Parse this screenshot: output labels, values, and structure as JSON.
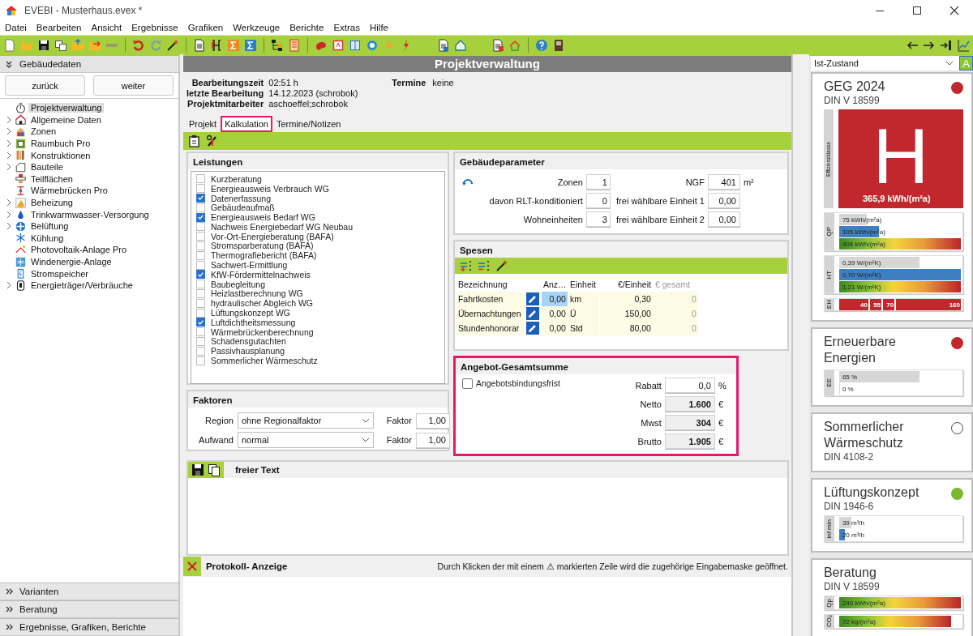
{
  "window": {
    "title": "EVEBI - Musterhaus.evex *"
  },
  "menu": [
    "Datei",
    "Bearbeiten",
    "Ansicht",
    "Ergebnisse",
    "Grafiken",
    "Werkzeuge",
    "Berichte",
    "Extras",
    "Hilfe"
  ],
  "sidebar": {
    "header": "Gebäudedaten",
    "back_button": "zurück",
    "next_button": "weiter",
    "items": [
      {
        "label": "Projektverwaltung",
        "expandable": false,
        "selected": true
      },
      {
        "label": "Allgemeine Daten",
        "expandable": true,
        "selected": false
      },
      {
        "label": "Zonen",
        "expandable": true,
        "selected": false
      },
      {
        "label": "Raumbuch Pro",
        "expandable": true,
        "selected": false
      },
      {
        "label": "Konstruktionen",
        "expandable": true,
        "selected": false
      },
      {
        "label": "Bauteile",
        "expandable": true,
        "selected": false
      },
      {
        "label": "Teilflächen",
        "expandable": false,
        "selected": false
      },
      {
        "label": "Wärmebrücken Pro",
        "expandable": false,
        "selected": false
      },
      {
        "label": "Beheizung",
        "expandable": true,
        "selected": false
      },
      {
        "label": "Trinkwarmwasser-Versorgung",
        "expandable": true,
        "selected": false
      },
      {
        "label": "Belüftung",
        "expandable": true,
        "selected": false
      },
      {
        "label": "Kühlung",
        "expandable": false,
        "selected": false
      },
      {
        "label": "Photovoltaik-Anlage Pro",
        "expandable": false,
        "selected": false
      },
      {
        "label": "Windenergie-Anlage",
        "expandable": false,
        "selected": false
      },
      {
        "label": "Stromspeicher",
        "expandable": false,
        "selected": false
      },
      {
        "label": "Energieträger/Verbräuche",
        "expandable": true,
        "selected": false
      }
    ],
    "sections": [
      "Varianten",
      "Beratung",
      "Ergebnisse, Grafiken, Berichte"
    ]
  },
  "page_title": "Projektverwaltung",
  "info": [
    {
      "label": "Bearbeitungszeit",
      "value": "02:51 h"
    },
    {
      "label": "letzte Bearbeitung",
      "value": "14.12.2023 (schrobok)"
    },
    {
      "label": "Projektmitarbeiter",
      "value": "aschoeffel;schrobok"
    }
  ],
  "termine": {
    "label": "Termine",
    "value": "keine"
  },
  "tabs": [
    {
      "label": "Projekt",
      "selected": false,
      "highlighted": false
    },
    {
      "label": "Kalkulation",
      "selected": true,
      "highlighted": true
    },
    {
      "label": "Termine/Notizen",
      "selected": false,
      "highlighted": false
    }
  ],
  "leistungen": {
    "title": "Leistungen",
    "items": [
      {
        "label": "Kurzberatung",
        "checked": false
      },
      {
        "label": "Energieausweis Verbrauch WG",
        "checked": false
      },
      {
        "label": "Datenerfassung",
        "checked": true
      },
      {
        "label": "Gebäudeaufmaß",
        "checked": false
      },
      {
        "label": "Energieausweis Bedarf WG",
        "checked": true
      },
      {
        "label": "Nachweis Energiebedarf WG Neubau",
        "checked": false
      },
      {
        "label": "Vor-Ort-Energieberatung (BAFA)",
        "checked": false
      },
      {
        "label": "Stromsparberatung (BAFA)",
        "checked": false
      },
      {
        "label": "Thermografiebericht (BAFA)",
        "checked": false
      },
      {
        "label": "Sachwert-Ermittlung",
        "checked": false
      },
      {
        "label": "KfW-Fördermittelnachweis",
        "checked": true
      },
      {
        "label": "Baubegleitung",
        "checked": false
      },
      {
        "label": "Heizlastberechnung WG",
        "checked": false
      },
      {
        "label": "hydraulischer Abgleich WG",
        "checked": false
      },
      {
        "label": "Lüftungskonzept WG",
        "checked": false
      },
      {
        "label": "Luftdichtheitsmessung",
        "checked": true
      },
      {
        "label": "Wärmebrückenberechnung",
        "checked": false
      },
      {
        "label": "Schadensgutachten",
        "checked": false
      },
      {
        "label": "Passivhausplanung",
        "checked": false
      },
      {
        "label": "Sommerlicher Wärmeschutz",
        "checked": false
      }
    ]
  },
  "faktoren": {
    "title": "Faktoren",
    "rows": [
      {
        "label": "Region",
        "value": "ohne Regionalfaktor",
        "factor_label": "Faktor",
        "factor": "1,00"
      },
      {
        "label": "Aufwand",
        "value": "normal",
        "factor_label": "Faktor",
        "factor": "1,00"
      }
    ]
  },
  "gebaeudeparameter": {
    "title": "Gebäudeparameter",
    "left_fields": [
      {
        "label": "Zonen",
        "value": "1"
      },
      {
        "label": "davon RLT-konditioniert",
        "value": "0"
      },
      {
        "label": "Wohneinheiten",
        "value": "3"
      }
    ],
    "right_fields": [
      {
        "label": "NGF",
        "value": "401",
        "unit": "m²"
      },
      {
        "label": "frei wählbare Einheit 1",
        "value": "0,00"
      },
      {
        "label": "frei wählbare Einheit 2",
        "value": "0,00"
      }
    ]
  },
  "spesen": {
    "title": "Spesen",
    "columns": [
      "Bezeichnung",
      "Anz…",
      "Einheit",
      "€/Einheit",
      "€ gesamt"
    ],
    "rows": [
      {
        "name": "Fahrtkosten",
        "count": "0,00",
        "unit": "km",
        "price": "0,30",
        "total": "0",
        "selected": true
      },
      {
        "name": "Übernachtungen",
        "count": "0,00",
        "unit": "Ü",
        "price": "150,00",
        "total": "0",
        "selected": false
      },
      {
        "name": "Stundenhonorar",
        "count": "0,00",
        "unit": "Std",
        "price": "80,00",
        "total": "0",
        "selected": false
      }
    ]
  },
  "angebot": {
    "title": "Angebot-Gesamtsumme",
    "highlighted": true,
    "checkbox": {
      "label": "Angebotsbindungsfrist",
      "checked": false
    },
    "fields": [
      {
        "label": "Rabatt",
        "value": "0,0",
        "unit": "%",
        "kind": "input"
      },
      {
        "label": "Netto",
        "value": "1.600",
        "unit": "€",
        "kind": "total"
      },
      {
        "label": "Mwst",
        "value": "304",
        "unit": "€",
        "kind": "total"
      },
      {
        "label": "Brutto",
        "value": "1.905",
        "unit": "€",
        "kind": "total"
      }
    ]
  },
  "freier_text": {
    "title": "freier Text"
  },
  "protokoll": {
    "title": "Protokoll- Anzeige",
    "hint": "Durch Klicken der mit einem ⚠ markierten Zeile wird die zugehörige Eingabemaske geöffnet."
  },
  "right_panel": {
    "variant": "Ist-Zustand",
    "variant_button": "A",
    "cards": [
      {
        "title": "GEG 2024",
        "subtitle": "DIN V 18599",
        "status": {
          "filled": true,
          "color": "#c1272d"
        },
        "efficiency": {
          "axis": "Effizienzklasse",
          "letter": "H",
          "value": "365,9 kWh/(m²a)"
        },
        "groups": [
          {
            "axis": "QP",
            "bars": [
              {
                "text": "75 kWh/(m²a)",
                "kind": "grey",
                "level": 0.23
              },
              {
                "text": "105 kWh/(m²a)",
                "kind": "blue",
                "level": 0.33
              },
              {
                "text": "406 kWh/(m²a)",
                "kind": "gradient",
                "level": 1
              }
            ]
          },
          {
            "axis": "HT",
            "bars": [
              {
                "text": "0,39 W/(m²K)",
                "kind": "grey",
                "level": 0.66
              },
              {
                "text": "0,70 W/(m²K)",
                "kind": "blue",
                "level": 1
              },
              {
                "text": "1,21 W/(m²K)",
                "kind": "gradient",
                "level": 1
              }
            ]
          }
        ],
        "scale": {
          "axis": "EH",
          "marks": [
            "40",
            "55",
            "70",
            "160"
          ]
        }
      },
      {
        "title": "Erneuerbare Energien",
        "status": {
          "filled": true,
          "color": "#c1272d"
        },
        "groups": [
          {
            "axis": "EE",
            "bars": [
              {
                "text": "65 %",
                "kind": "grey",
                "level": 0.66
              },
              {
                "text": "0 %",
                "kind": "grey",
                "level": 0
              }
            ]
          }
        ]
      },
      {
        "title": "Sommerlicher Wärmeschutz",
        "subtitle": "DIN 4108-2",
        "status": {
          "filled": false
        }
      },
      {
        "title": "Lüftungskonzept",
        "subtitle": "DIN 1946-6",
        "status": {
          "filled": true,
          "color": "#7ab82e"
        },
        "groups": [
          {
            "axis": "inf min",
            "bars": [
              {
                "text": "39 m³/h",
                "kind": "grey",
                "level": 0.1
              },
              {
                "text": "20 m³/h",
                "kind": "blue",
                "level": 0.05
              }
            ]
          }
        ]
      },
      {
        "title": "Beratung",
        "subtitle": "DIN V 18599",
        "groups": [
          {
            "axis": "Qp",
            "bars": [
              {
                "text": "240 kWh/(m²a)",
                "kind": "gradient",
                "level": 1
              }
            ]
          },
          {
            "axis": "CO₂",
            "bars": [
              {
                "text": "72 kg/(m²a)",
                "kind": "gradient",
                "level": 0.92
              }
            ]
          }
        ]
      }
    ]
  }
}
